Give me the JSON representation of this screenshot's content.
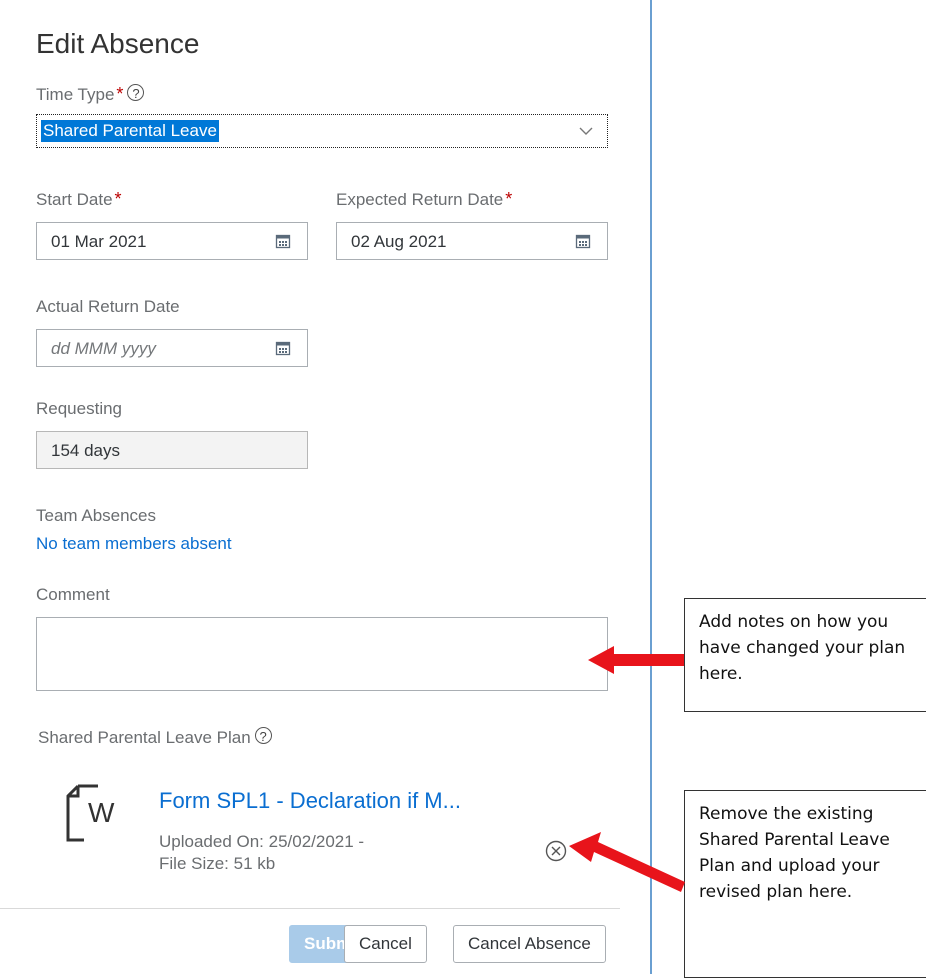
{
  "dialog": {
    "title": "Edit Absence",
    "time_type": {
      "label": "Time Type",
      "required_mark": "*",
      "help": "?",
      "value": "Shared Parental Leave"
    },
    "start_date": {
      "label": "Start Date",
      "required_mark": "*",
      "value": "01 Mar 2021"
    },
    "expected_return": {
      "label": "Expected Return Date",
      "required_mark": "*",
      "value": "02 Aug 2021"
    },
    "actual_return": {
      "label": "Actual Return Date",
      "placeholder": "dd MMM yyyy"
    },
    "requesting": {
      "label": "Requesting",
      "value": "154 days"
    },
    "team_absences": {
      "label": "Team Absences",
      "link": "No team members absent"
    },
    "comment": {
      "label": "Comment",
      "value": ""
    },
    "plan": {
      "label": "Shared Parental Leave Plan",
      "help": "?",
      "file_name": "Form SPL1 - Declaration if M...",
      "uploaded_on": "Uploaded On: 25/02/2021 -",
      "file_size": "File Size: 51 kb",
      "icon_letter": "W"
    },
    "buttons": {
      "submit": "Submit",
      "cancel": "Cancel",
      "cancel_absence": "Cancel Absence"
    }
  },
  "callouts": {
    "comment_note": "Add notes on how you have changed your plan here.",
    "plan_note": "Remove the existing Shared Parental Leave Plan and upload your revised plan here."
  },
  "colors": {
    "accent": "#0a6ed1",
    "required": "#bb0000",
    "arrow": "#e8141b",
    "selection": "#0078d7"
  }
}
